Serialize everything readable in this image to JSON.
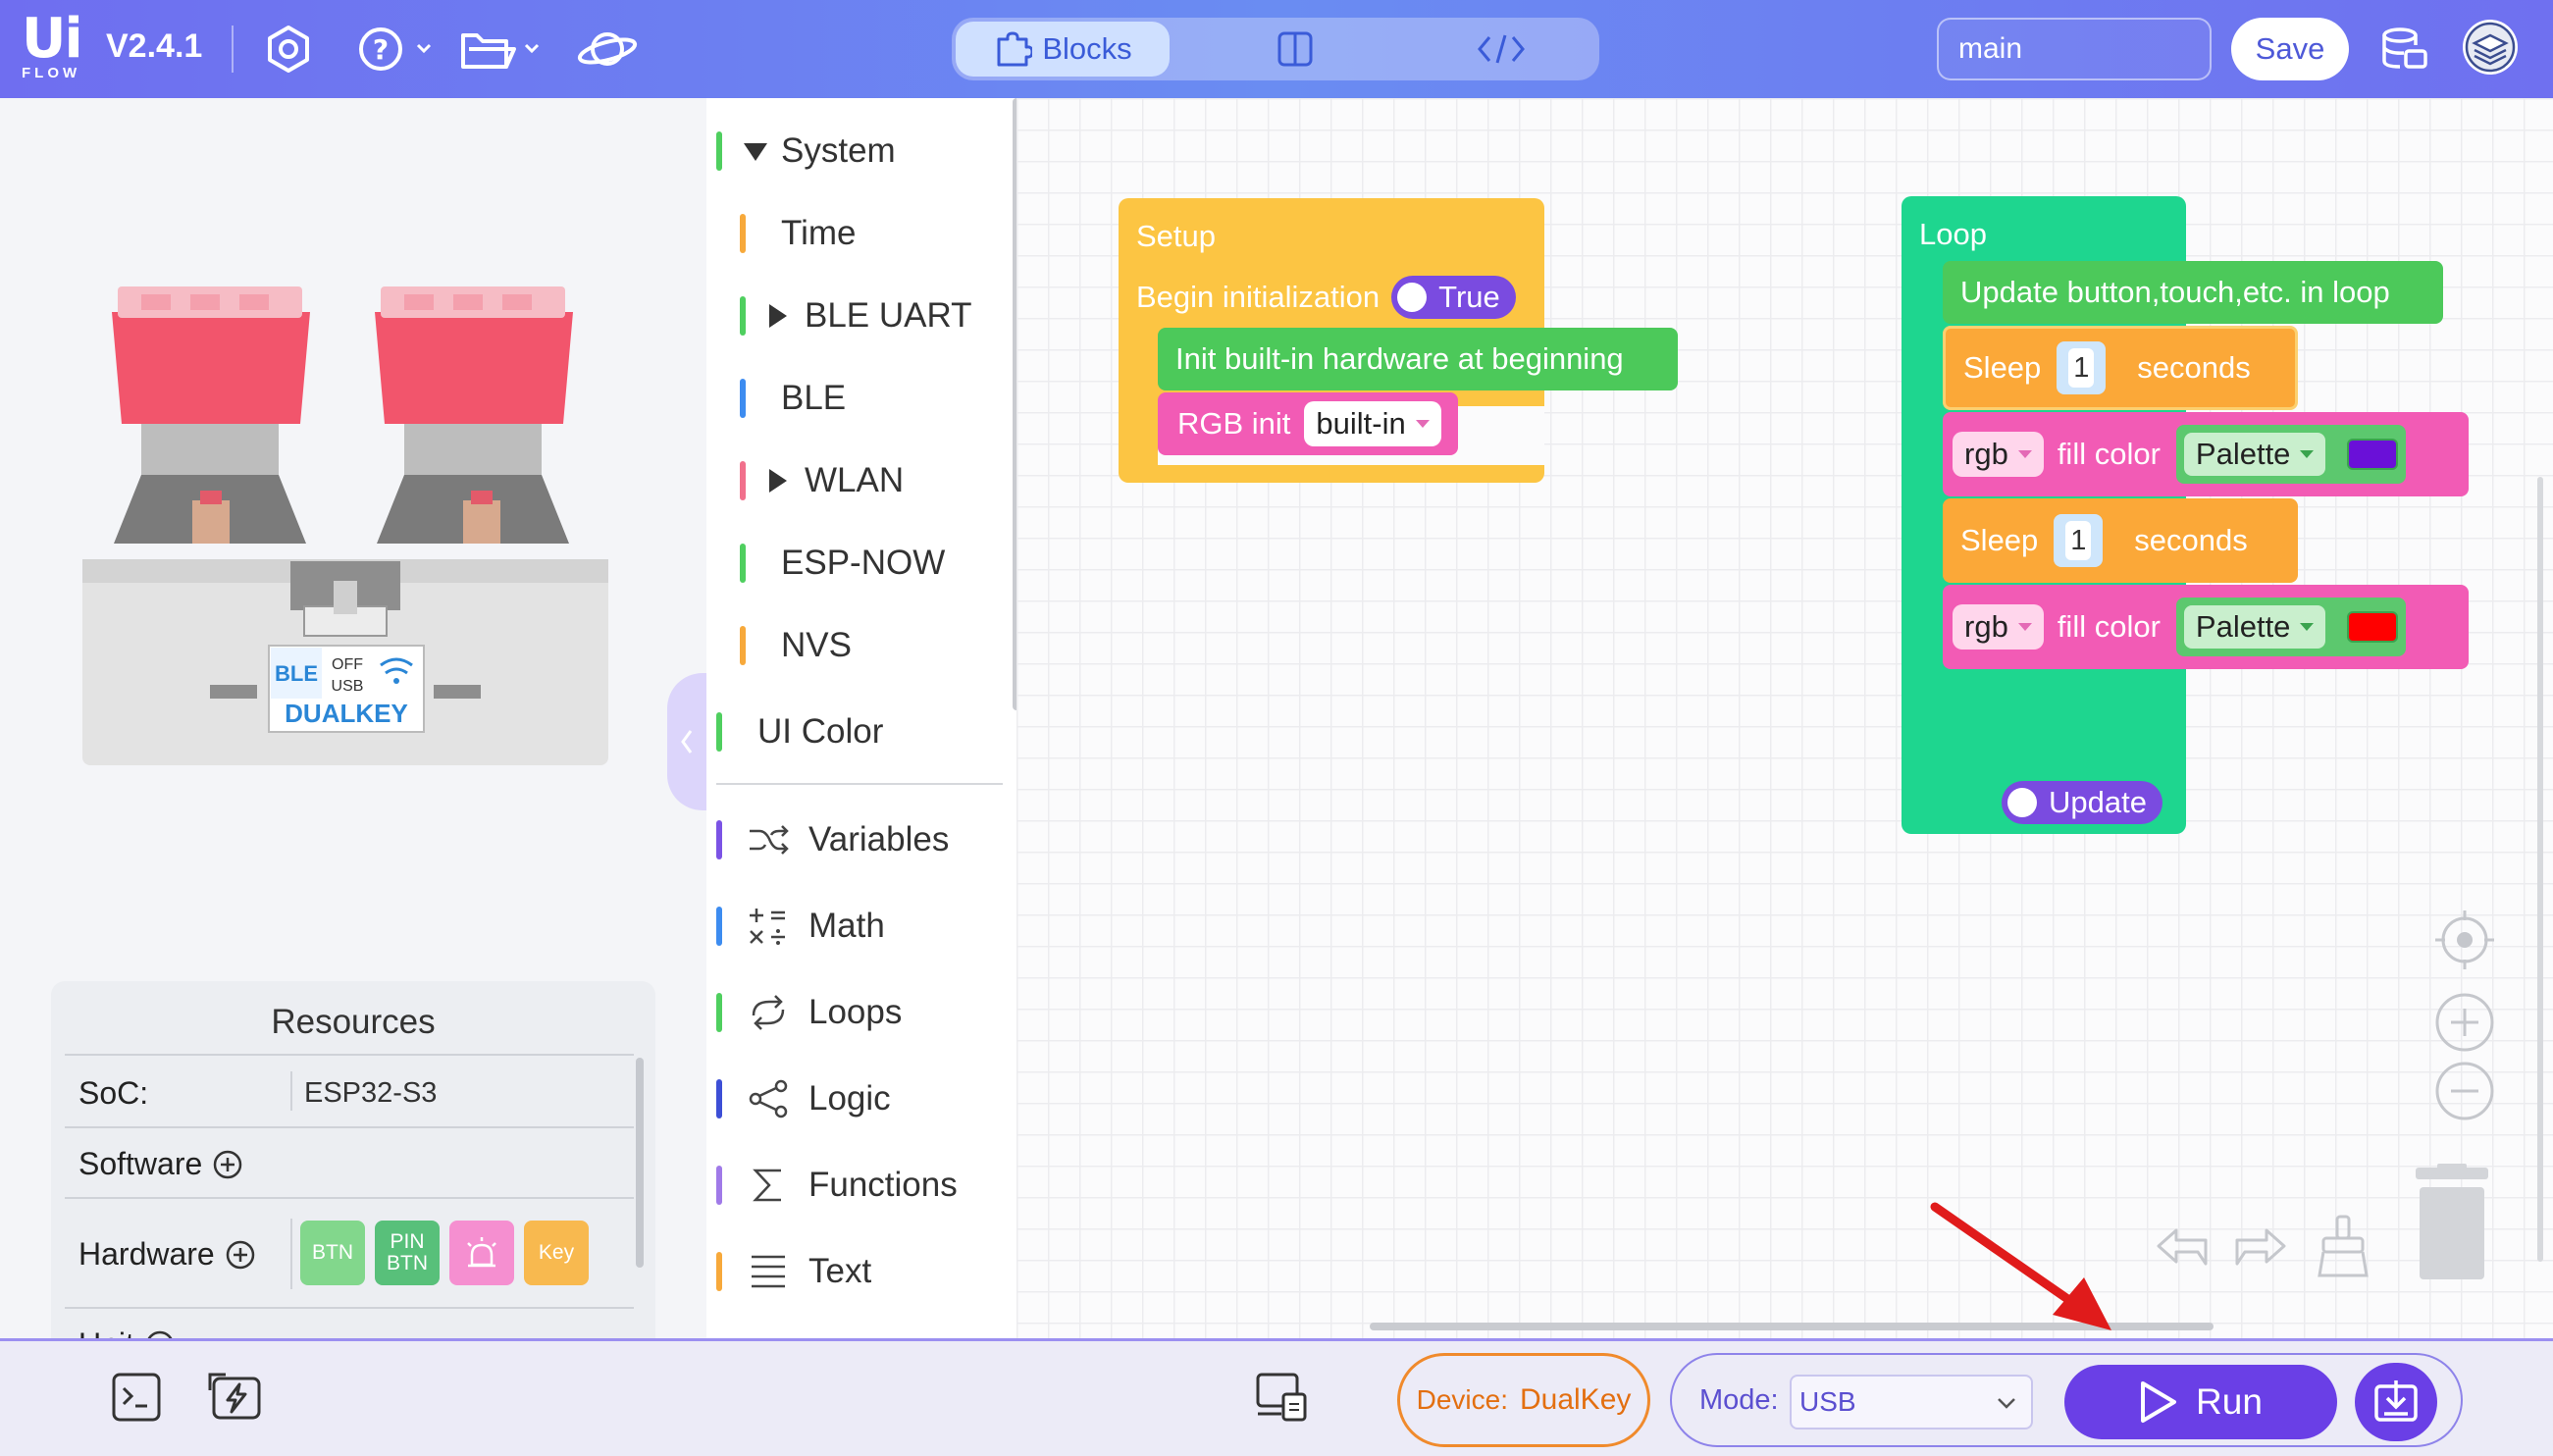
{
  "header": {
    "logo_main": "Ui",
    "logo_sub": "FLOW",
    "version": "V2.4.1",
    "mode_tabs": [
      {
        "label": "Blocks",
        "active": true
      }
    ],
    "branch_value": "main",
    "save_label": "Save"
  },
  "sidebar": {
    "device_label_ble": "BLE",
    "device_label_off": "OFF",
    "device_label_usb": "USB",
    "device_label_name": "DUALKEY"
  },
  "resources": {
    "title": "Resources",
    "soc_label": "SoC:",
    "soc_value": "ESP32-S3",
    "software_label": "Software",
    "hardware_label": "Hardware",
    "unit_label": "Unit",
    "hardware_badges": [
      {
        "label": "BTN",
        "color": "#82d78c"
      },
      {
        "label": "PIN BTN",
        "color": "#58c07a"
      },
      {
        "label": "",
        "color": "#f58fd0"
      },
      {
        "label": "Key",
        "color": "#f8b94f"
      }
    ]
  },
  "categories": [
    {
      "label": "System",
      "color": "#4fcf5f",
      "expanded": true
    },
    {
      "label": "Time",
      "color": "#f7a93b"
    },
    {
      "label": "BLE UART",
      "color": "#4fcf5f",
      "collapsed": true
    },
    {
      "label": "BLE",
      "color": "#3d8cf0"
    },
    {
      "label": "WLAN",
      "color": "#f1708c",
      "collapsed": true
    },
    {
      "label": "ESP-NOW",
      "color": "#4fcf5f"
    },
    {
      "label": "NVS",
      "color": "#f7a93b"
    },
    {
      "label": "UI Color",
      "color": "#4fcf5f"
    },
    {
      "label": "Variables",
      "color": "#7b53e5"
    },
    {
      "label": "Math",
      "color": "#3d8cf0"
    },
    {
      "label": "Loops",
      "color": "#4fcf5f"
    },
    {
      "label": "Logic",
      "color": "#3d4fd6"
    },
    {
      "label": "Functions",
      "color": "#a07ae8"
    },
    {
      "label": "Text",
      "color": "#f7a93b"
    }
  ],
  "blocks": {
    "setup": {
      "title": "Setup",
      "begin_label": "Begin initialization",
      "begin_value": "True",
      "init_hw": "Init built-in hardware at beginning",
      "rgb_init": "RGB init",
      "rgb_init_value": "built-in"
    },
    "loop": {
      "title": "Loop",
      "update": "Update button,touch,etc. in loop",
      "sleep1_label": "Sleep",
      "sleep1_value": "1",
      "sleep1_unit": "seconds",
      "fill1_target": "rgb",
      "fill1_label": "fill color",
      "fill1_palette": "Palette",
      "fill1_color": "#6a10d8",
      "sleep2_label": "Sleep",
      "sleep2_value": "1",
      "sleep2_unit": "seconds",
      "fill2_target": "rgb",
      "fill2_label": "fill color",
      "fill2_palette": "Palette",
      "fill2_color": "#ff0000",
      "update_toggle": "Update"
    }
  },
  "footer": {
    "device_label": "Device:",
    "device_value": "DualKey",
    "mode_label": "Mode:",
    "mode_value": "USB",
    "run_label": "Run"
  }
}
